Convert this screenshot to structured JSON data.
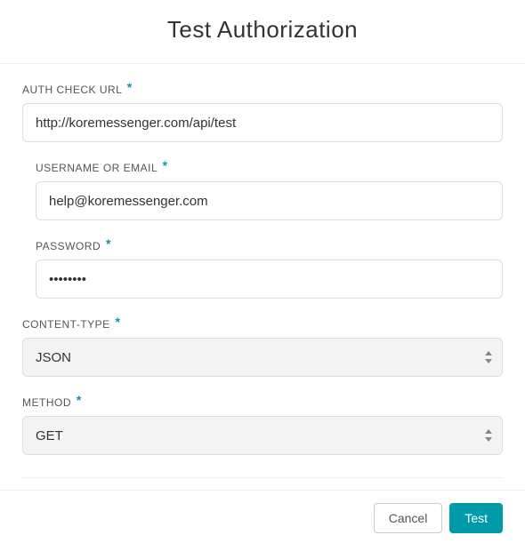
{
  "header": {
    "title": "Test Authorization"
  },
  "form": {
    "authUrl": {
      "label": "AUTH CHECK URL",
      "value": "http://koremessenger.com/api/test",
      "required": true
    },
    "username": {
      "label": "USERNAME OR EMAIL",
      "value": "help@koremessenger.com",
      "required": true
    },
    "password": {
      "label": "PASSWORD",
      "value": "••••••••",
      "required": true
    },
    "contentType": {
      "label": "CONTENT-TYPE",
      "value": "JSON",
      "required": true
    },
    "method": {
      "label": "METHOD",
      "value": "GET",
      "required": true
    }
  },
  "footer": {
    "cancel": "Cancel",
    "test": "Test"
  }
}
